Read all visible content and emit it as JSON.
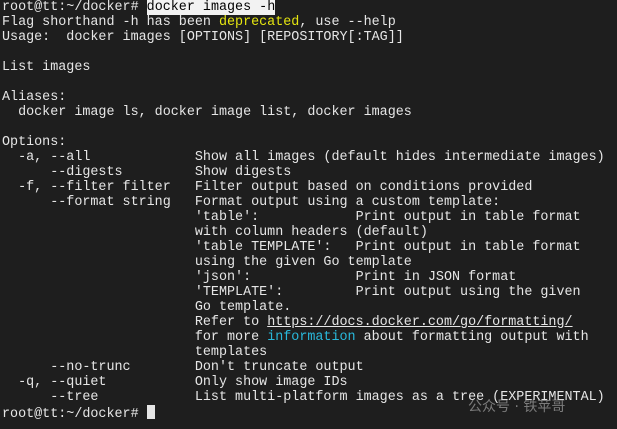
{
  "terminal": {
    "lines": [
      [
        {
          "t": "root@tt:~/docker# "
        },
        {
          "t": "docker images -h",
          "c": "hl"
        }
      ],
      [
        {
          "t": "Flag shorthand -h has been "
        },
        {
          "t": "deprecated",
          "c": "yellow"
        },
        {
          "t": ", use --help"
        }
      ],
      [
        {
          "t": "Usage:  docker images [OPTIONS] [REPOSITORY[:TAG]]"
        }
      ],
      [
        {
          "t": ""
        }
      ],
      [
        {
          "t": "List images"
        }
      ],
      [
        {
          "t": ""
        }
      ],
      [
        {
          "t": "Aliases:"
        }
      ],
      [
        {
          "t": "  docker image ls, docker image list, docker images"
        }
      ],
      [
        {
          "t": ""
        }
      ],
      [
        {
          "t": "Options:"
        }
      ],
      [
        {
          "t": "  -a, --all             Show all images (default hides intermediate images)"
        }
      ],
      [
        {
          "t": "      --digests         Show digests"
        }
      ],
      [
        {
          "t": "  -f, --filter filter   Filter output based on conditions provided"
        }
      ],
      [
        {
          "t": "      --format string   Format output using a custom template:"
        }
      ],
      [
        {
          "t": "                        'table':            Print output in table format"
        }
      ],
      [
        {
          "t": "                        with column headers (default)"
        }
      ],
      [
        {
          "t": "                        'table TEMPLATE':   Print output in table format"
        }
      ],
      [
        {
          "t": "                        using the given Go template"
        }
      ],
      [
        {
          "t": "                        'json':             Print in JSON format"
        }
      ],
      [
        {
          "t": "                        'TEMPLATE':         Print output using the given"
        }
      ],
      [
        {
          "t": "                        Go template."
        }
      ],
      [
        {
          "t": "                        Refer to "
        },
        {
          "t": "https://docs.docker.com/go/formatting/",
          "c": "link"
        }
      ],
      [
        {
          "t": "                        for more "
        },
        {
          "t": "information",
          "c": "cyan"
        },
        {
          "t": " about formatting output with"
        }
      ],
      [
        {
          "t": "                        templates"
        }
      ],
      [
        {
          "t": "      --no-trunc        Don't truncate output"
        }
      ],
      [
        {
          "t": "  -q, --quiet           Only show image IDs"
        }
      ],
      [
        {
          "t": "      --tree            List multi-platform images as a tree (EXPERIMENTAL)"
        }
      ],
      [
        {
          "t": "root@tt:~/docker# "
        },
        {
          "t": "",
          "c": "cursor"
        }
      ]
    ]
  },
  "watermark": "公众号 · 铁苹哥"
}
